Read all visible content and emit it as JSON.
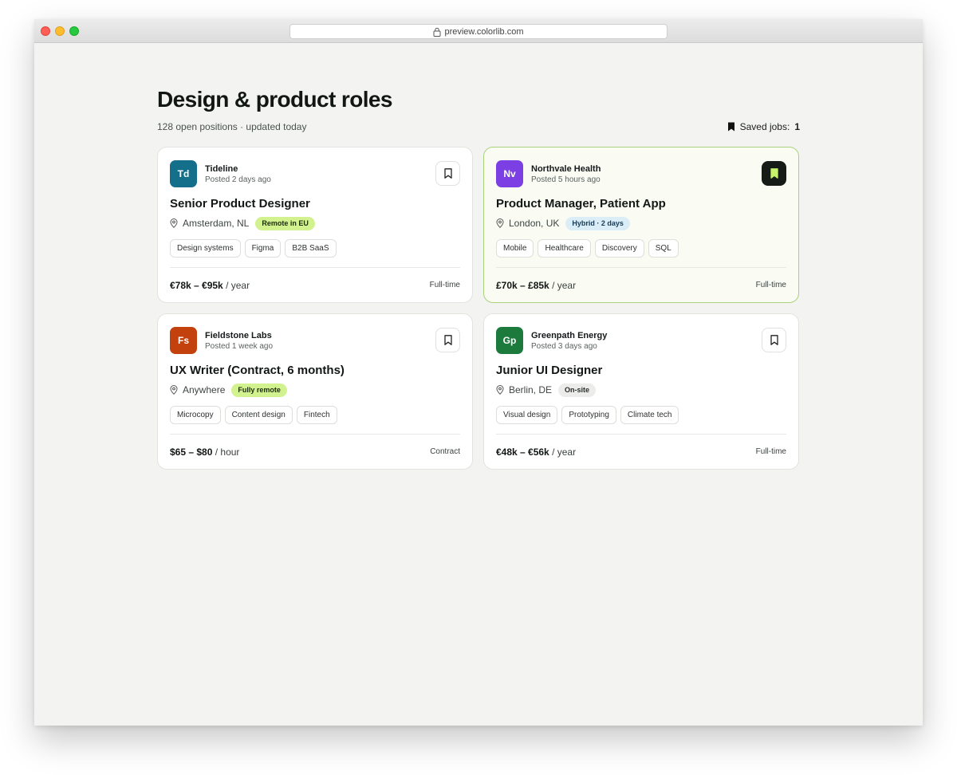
{
  "browser": {
    "url": "preview.colorlib.com"
  },
  "header": {
    "title": "Design & product roles",
    "subtitle": "128 open positions · updated today",
    "saved_label": "Saved jobs:",
    "saved_count": "1"
  },
  "jobs": [
    {
      "logo": "Td",
      "logo_color": "#14708a",
      "company": "Tideline",
      "posted": "Posted 2 days ago",
      "title": "Senior Product Designer",
      "location": "Amsterdam, NL",
      "badge": "Remote in EU",
      "badge_bg": "#d2f28f",
      "badge_fg": "#1b2b0d",
      "tags": [
        "Design systems",
        "Figma",
        "B2B SaaS"
      ],
      "salary": "€78k – €95k",
      "period": "/ year",
      "type": "Full-time",
      "saved": false
    },
    {
      "logo": "Nv",
      "logo_color": "#7b3fe4",
      "company": "Northvale Health",
      "posted": "Posted 5 hours ago",
      "title": "Product Manager, Patient App",
      "location": "London, UK",
      "badge": "Hybrid · 2 days",
      "badge_bg": "#dbeef8",
      "badge_fg": "#173b57",
      "tags": [
        "Mobile",
        "Healthcare",
        "Discovery",
        "SQL"
      ],
      "salary": "£70k – £85k",
      "period": "/ year",
      "type": "Full-time",
      "saved": true
    },
    {
      "logo": "Fs",
      "logo_color": "#c2410c",
      "company": "Fieldstone Labs",
      "posted": "Posted 1 week ago",
      "title": "UX Writer (Contract, 6 months)",
      "location": "Anywhere",
      "badge": "Fully remote",
      "badge_bg": "#d2f28f",
      "badge_fg": "#1b2b0d",
      "tags": [
        "Microcopy",
        "Content design",
        "Fintech"
      ],
      "salary": "$65 – $80",
      "period": "/ hour",
      "type": "Contract",
      "saved": false
    },
    {
      "logo": "Gp",
      "logo_color": "#1c7a3d",
      "company": "Greenpath Energy",
      "posted": "Posted 3 days ago",
      "title": "Junior UI Designer",
      "location": "Berlin, DE",
      "badge": "On-site",
      "badge_bg": "#ececea",
      "badge_fg": "#2a2e2c",
      "tags": [
        "Visual design",
        "Prototyping",
        "Climate tech"
      ],
      "salary": "€48k – €56k",
      "period": "/ year",
      "type": "Full-time",
      "saved": false
    }
  ],
  "colors": {
    "accent_dark": "#161b17",
    "accent_green": "#c6f36b",
    "featured_border": "#a9d27c"
  }
}
